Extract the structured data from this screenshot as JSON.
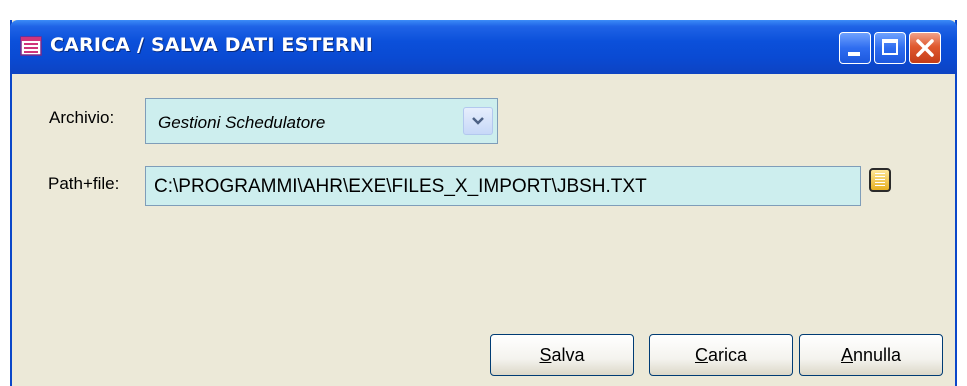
{
  "window": {
    "title": "CARICA / SALVA DATI ESTERNI"
  },
  "form": {
    "archivio_label": "Archivio:",
    "archivio_value": "Gestioni Schedulatore",
    "path_label": "Path+file:",
    "path_value": "C:\\PROGRAMMI\\AHR\\EXE\\FILES_X_IMPORT\\JBSH.TXT"
  },
  "buttons": {
    "salva": {
      "mnemonic": "S",
      "rest": "alva"
    },
    "carica": {
      "mnemonic": "C",
      "rest": "arica"
    },
    "annulla": {
      "mnemonic": "A",
      "rest": "nnulla"
    }
  },
  "icons": {
    "title": "form-icon",
    "dropdown": "chevron-down-icon",
    "browse": "browse-file-icon",
    "minimize": "minimize-icon",
    "maximize": "maximize-icon",
    "close": "close-icon"
  },
  "colors": {
    "titlebar": "#0a4ad3",
    "window_bg": "#ece9d8",
    "field_bg": "#cdeeee",
    "close_button": "#e0592f"
  }
}
